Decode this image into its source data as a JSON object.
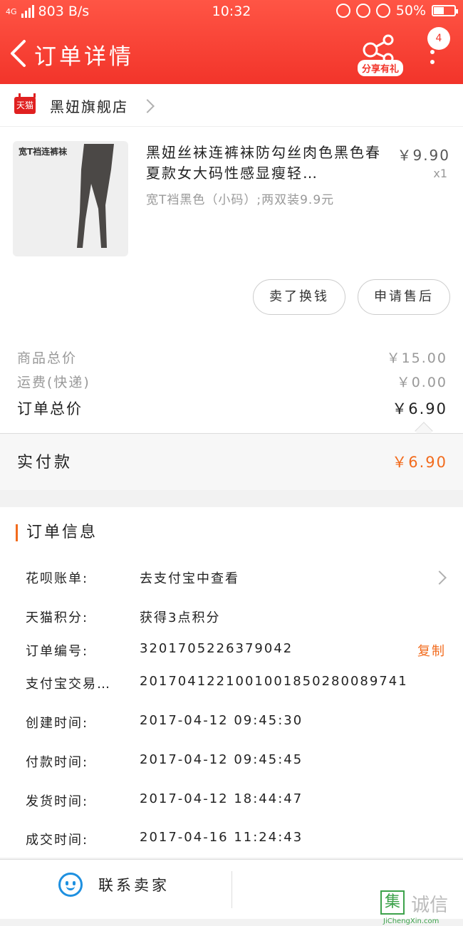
{
  "status_bar": {
    "network": "4G",
    "speed": "803 B/s",
    "time": "10:32",
    "battery": "50%",
    "battery_level": 0.5
  },
  "nav": {
    "title": "订单详情",
    "share_label": "分享有礼",
    "badge_count": "4"
  },
  "shop": {
    "logo_text": "天猫",
    "name": "黑妞旗舰店"
  },
  "product": {
    "image_tag": "宽T裆连裤袜",
    "title": "黑妞丝袜连裤袜防勾丝肉色黑色春夏款女大码性感显瘦轻…",
    "sku": "宽T裆黑色（小码）;两双装9.9元",
    "price": "￥9.90",
    "quantity": "x1",
    "buttons": {
      "return": "卖了换钱",
      "after_sale": "申请售后"
    }
  },
  "totals": {
    "goods_label": "商品总价",
    "goods_value": "￥15.00",
    "shipping_label": "运费(快递)",
    "shipping_value": "￥0.00",
    "order_label": "订单总价",
    "order_value": "￥6.90",
    "paid_label": "实付款",
    "paid_value": "￥6.90"
  },
  "order_info": {
    "heading": "订单信息",
    "rows": [
      {
        "label": "花呗账单:",
        "value": "去支付宝中查看"
      },
      {
        "label": "天猫积分:",
        "value": "获得3点积分"
      },
      {
        "label": "订单编号:",
        "value": "3201705226379042"
      },
      {
        "label": "支付宝交易…",
        "value": "2017041221001001850280089741"
      },
      {
        "label": "创建时间:",
        "value": "2017-04-12 09:45:30"
      },
      {
        "label": "付款时间:",
        "value": "2017-04-12 09:45:45"
      },
      {
        "label": "发货时间:",
        "value": "2017-04-12 18:44:47"
      },
      {
        "label": "成交时间:",
        "value": "2017-04-16 11:24:43"
      }
    ],
    "copy_label": "复制"
  },
  "footer": {
    "contact_label": "联系卖家"
  },
  "watermark": {
    "box_char": "集",
    "text": "诚信",
    "url": "JiChengXin.com"
  },
  "colors": {
    "header": "#f2342a",
    "accent": "#f26b1d",
    "contact_icon": "#1e90e0"
  }
}
